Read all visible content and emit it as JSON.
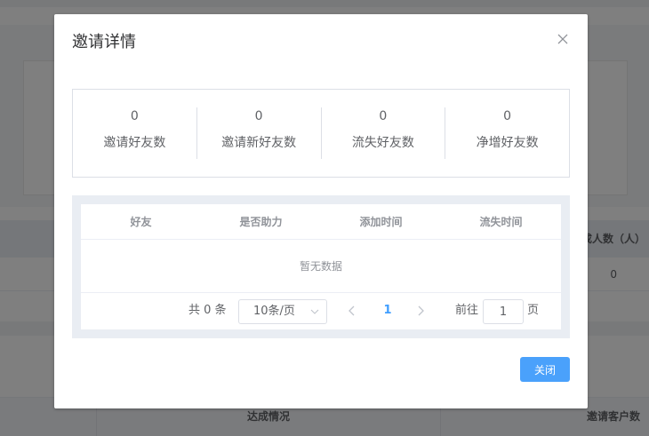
{
  "background": {
    "table_header_right": "成人数（人）",
    "row_value": "0",
    "footer_col_1": "达成情况",
    "footer_col_2": "邀请客户数"
  },
  "dialog": {
    "title": "邀请详情",
    "stats": [
      {
        "value": "0",
        "label": "邀请好友数"
      },
      {
        "value": "0",
        "label": "邀请新好友数"
      },
      {
        "value": "0",
        "label": "流失好友数"
      },
      {
        "value": "0",
        "label": "净增好友数"
      }
    ],
    "table": {
      "headers": [
        "好友",
        "是否助力",
        "添加时间",
        "流失时间"
      ],
      "empty_text": "暂无数据"
    },
    "pagination": {
      "total": "共 0 条",
      "page_size": "10条/页",
      "current_page": "1",
      "goto_label": "前往",
      "goto_value": "1",
      "page_unit": "页"
    },
    "close_label": "关闭"
  },
  "colors": {
    "primary": "#409eff",
    "button": "#4aa1fb",
    "border": "#dcdfe6"
  }
}
